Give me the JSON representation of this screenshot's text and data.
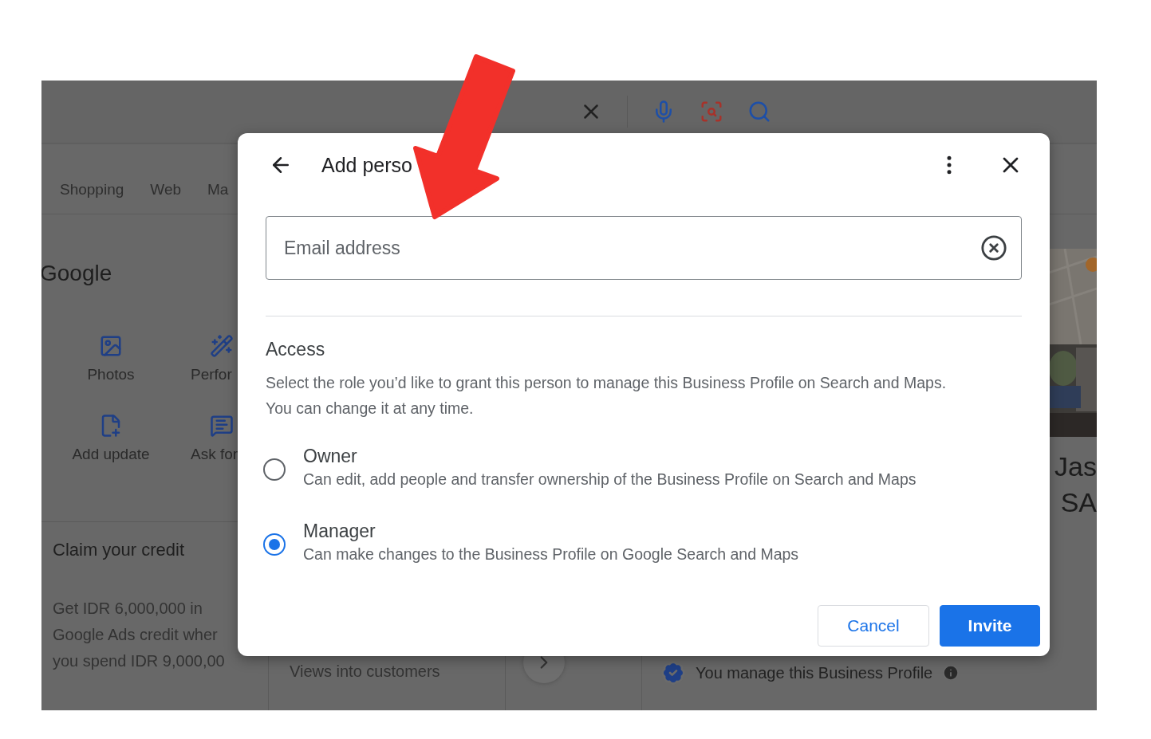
{
  "background_page": {
    "tabs": [
      {
        "label": "Shopping"
      },
      {
        "label": "Web"
      },
      {
        "label": "Ma"
      }
    ],
    "business_name": "Google",
    "actions": [
      {
        "kind": "photos",
        "label": "Photos"
      },
      {
        "kind": "performance",
        "label": "Perfor"
      },
      {
        "kind": "post",
        "label": "Add update"
      },
      {
        "kind": "question",
        "label": "Ask for"
      }
    ],
    "cards": [
      {
        "title": "Claim your credit",
        "lines": [
          "Get IDR 6,000,000 in",
          "Google Ads credit wher",
          "you spend IDR 9,000,00"
        ]
      },
      {
        "title": "Views into customers"
      }
    ],
    "listing": {
      "picture": {
        "kind": "picture"
      },
      "title_lines": [
        "Jas",
        "SA"
      ],
      "managed_note": "You manage this Business Profile"
    }
  },
  "dialog": {
    "title": "Add perso",
    "email": {
      "placeholder": "Email address"
    },
    "access": {
      "heading": "Access",
      "description": "Select the role you’d like to grant this person to manage this Business Profile on Search and Maps. You can change it at any time."
    },
    "roles": [
      {
        "name": "Owner",
        "description": "Can edit, add people and transfer ownership of the Business Profile on Search and Maps",
        "selected": false
      },
      {
        "name": "Manager",
        "description": "Can make changes to the Business Profile on Google Search and Maps",
        "selected": true
      }
    ],
    "buttons": [
      {
        "kind": "secondary",
        "label": "Cancel"
      },
      {
        "kind": "primary",
        "label": "Invite"
      }
    ]
  }
}
